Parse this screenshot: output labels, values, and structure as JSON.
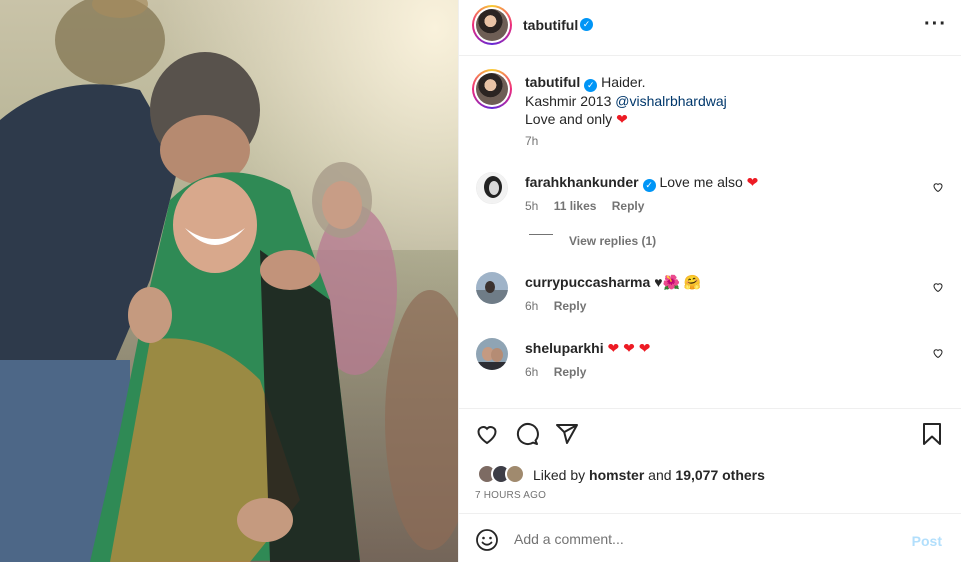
{
  "post": {
    "username": "tabutiful",
    "verified": true
  },
  "caption": {
    "username": "tabutiful",
    "line1": "Haider.",
    "line2_prefix": "Kashmir 2013 ",
    "mention": "@vishalrbhardwaj",
    "line3": "Love and only",
    "time": "7h"
  },
  "comments": [
    {
      "username": "farahkhankunder",
      "verified": true,
      "text": "Love me also",
      "time": "5h",
      "likes": "11 likes",
      "reply_label": "Reply",
      "view_replies": "View replies (1)"
    },
    {
      "username": "currypuccasharma",
      "verified": false,
      "text": "♥🌺 🤗",
      "time": "6h",
      "reply_label": "Reply"
    },
    {
      "username": "sheluparkhi",
      "verified": false,
      "text": "",
      "time": "6h",
      "reply_label": "Reply"
    }
  ],
  "likes": {
    "prefix": "Liked by ",
    "user": "homster",
    "middle": " and ",
    "count": "19,077 others"
  },
  "timestamp": "7 HOURS AGO",
  "add_comment": {
    "placeholder": "Add a comment...",
    "post_label": "Post"
  },
  "icons": {
    "more": "more-options-icon",
    "like": "heart-icon",
    "comment": "comment-icon",
    "share": "share-icon",
    "save": "bookmark-icon",
    "emoji": "emoji-icon"
  },
  "colors": {
    "accent_blue": "#0095f6",
    "post_disabled": "#b2dffc",
    "heart_red": "#ed1b24",
    "mention": "#00376b"
  }
}
